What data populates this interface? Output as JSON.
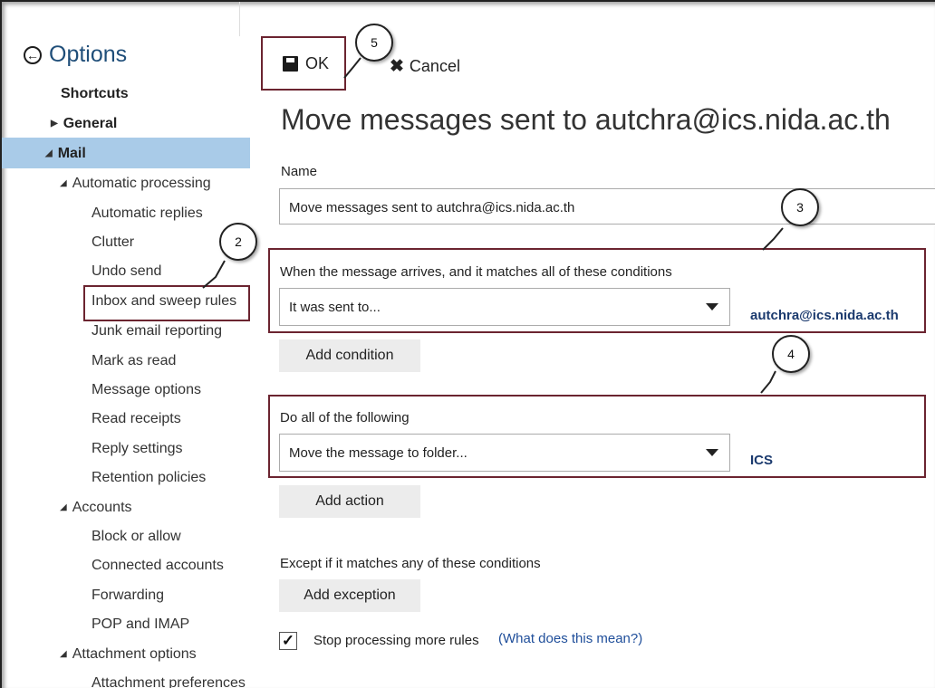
{
  "sidebar": {
    "title": "Options",
    "items": [
      {
        "label": "Shortcuts",
        "bold": true
      },
      {
        "label": "General",
        "bold": true,
        "expander": "right"
      },
      {
        "label": "Mail",
        "bold": true,
        "expander": "down",
        "selected": true
      },
      {
        "label": "Automatic processing",
        "expander": "down"
      },
      {
        "label": "Automatic replies"
      },
      {
        "label": "Clutter"
      },
      {
        "label": "Undo send"
      },
      {
        "label": "Inbox and sweep rules",
        "highlighted": true
      },
      {
        "label": "Junk email reporting"
      },
      {
        "label": "Mark as read"
      },
      {
        "label": "Message options"
      },
      {
        "label": "Read receipts"
      },
      {
        "label": "Reply settings"
      },
      {
        "label": "Retention policies"
      },
      {
        "label": "Accounts",
        "expander": "down"
      },
      {
        "label": "Block or allow"
      },
      {
        "label": "Connected accounts"
      },
      {
        "label": "Forwarding"
      },
      {
        "label": "POP and IMAP"
      },
      {
        "label": "Attachment options",
        "expander": "down"
      },
      {
        "label": "Attachment preferences"
      }
    ]
  },
  "toolbar": {
    "ok_label": "OK",
    "cancel_label": "Cancel"
  },
  "heading": "Move messages sent to autchra@ics.nida.ac.th",
  "name_label": "Name",
  "name_value": "Move messages sent to autchra@ics.nida.ac.th",
  "condition": {
    "label": "When the message arrives, and it matches all of these conditions",
    "selected": "It was sent to...",
    "value": "autchra@ics.nida.ac.th",
    "add_label": "Add condition"
  },
  "action": {
    "label": "Do all of the following",
    "selected": "Move the message to folder...",
    "value": "ICS",
    "add_label": "Add action"
  },
  "exception": {
    "label": "Except if it matches any of these conditions",
    "add_label": "Add exception"
  },
  "stop_processing": {
    "label": "Stop processing more rules",
    "checked": true,
    "help": "(What does this mean?)"
  },
  "callouts": {
    "c2": "2",
    "c3": "3",
    "c4": "4",
    "c5": "5"
  },
  "colors": {
    "selected_bg": "#a9cbe8",
    "annotation_border": "#6b2430",
    "link": "#1f4e9a"
  }
}
